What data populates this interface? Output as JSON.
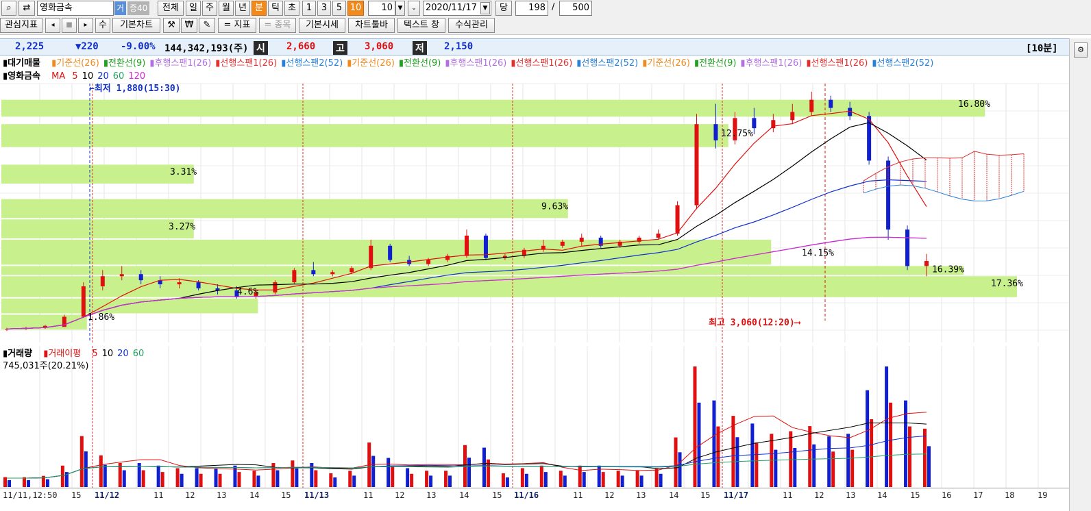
{
  "toolbar": {
    "stock_name": "영화금속",
    "tag_trade": "거",
    "tag_rate": "증40",
    "period_all": "전체",
    "period_day": "일",
    "period_week": "주",
    "period_month": "월",
    "period_year": "년",
    "period_minute": "분",
    "period_tick": "틱",
    "period_second": "초",
    "n1": "1",
    "n3": "3",
    "n5": "5",
    "n10": "10",
    "interval_value": "10",
    "date_value": "2020/11/17",
    "dang_label": "당",
    "count_value": "198",
    "count_slash": "/",
    "count_total": "500"
  },
  "toolbar2": {
    "interest": "관심지표",
    "su": "수",
    "basic_chart": "기본차트",
    "indicator": "= 지표",
    "item": "= 종목",
    "basic_quote": "기본시세",
    "chart_toolbar": "차트툴바",
    "text_window": "텍스트 창",
    "formula": "수식관리"
  },
  "quote": {
    "price": "2,225",
    "change": "▼220",
    "change_pct": "-9.00%",
    "volume": "144,342,193(주)",
    "open_label": "시",
    "open": "2,660",
    "high_label": "고",
    "high": "3,060",
    "low_label": "저",
    "low": "2,150",
    "interval": "[10분]"
  },
  "legend1": {
    "title": "대기매물",
    "items": [
      {
        "label": "기준선(26)",
        "color": "#f08a1c"
      },
      {
        "label": "전환선(9)",
        "color": "#20a020"
      },
      {
        "label": "후행스팬1(26)",
        "color": "#b070e0"
      },
      {
        "label": "선행스팬1(26)",
        "color": "#e03030"
      },
      {
        "label": "선행스팬2(52)",
        "color": "#2a80d8"
      },
      {
        "label": "기준선(26)",
        "color": "#f08a1c"
      },
      {
        "label": "전환선(9)",
        "color": "#20a020"
      },
      {
        "label": "후행스팬1(26)",
        "color": "#b070e0"
      },
      {
        "label": "선행스팬1(26)",
        "color": "#e03030"
      },
      {
        "label": "선행스팬2(52)",
        "color": "#2a80d8"
      },
      {
        "label": "기준선(26)",
        "color": "#f08a1c"
      },
      {
        "label": "전환선(9)",
        "color": "#20a020"
      },
      {
        "label": "후행스팬1(26)",
        "color": "#b070e0"
      },
      {
        "label": "선행스팬1(26)",
        "color": "#e03030"
      },
      {
        "label": "선행스팬2(52)",
        "color": "#2a80d8"
      }
    ]
  },
  "legend2": {
    "title": "영화금속",
    "ma": "MA",
    "items": [
      {
        "label": "5",
        "color": "#e01010"
      },
      {
        "label": "10",
        "color": "#000000"
      },
      {
        "label": "20",
        "color": "#1030d0"
      },
      {
        "label": "60",
        "color": "#20a060"
      },
      {
        "label": "120",
        "color": "#e020e0"
      }
    ]
  },
  "annotations": {
    "low_mark": "←최저 1,880(15:30)",
    "high_mark": "최고 3,060(12:20)⟶",
    "pcts": [
      "16.80%",
      "12.75%",
      "3.31%",
      "9.63%",
      "3.27%",
      "14.15%",
      "16.39%",
      "4.6%",
      "17.36%",
      "1.86%"
    ]
  },
  "volume_legend": {
    "title": "거래량",
    "ma_title": "거래이평",
    "items": [
      {
        "label": "5",
        "color": "#e01010"
      },
      {
        "label": "10",
        "color": "#000000"
      },
      {
        "label": "20",
        "color": "#1030d0"
      },
      {
        "label": "60",
        "color": "#20a060"
      }
    ],
    "current": "745,031주(20.21%)"
  },
  "xaxis": {
    "labels": [
      "11/11,12:50",
      "15",
      "11/12",
      "11",
      "12",
      "13",
      "14",
      "15",
      "11/13",
      "11",
      "12",
      "13",
      "14",
      "15",
      "11/16",
      "11",
      "12",
      "13",
      "14",
      "15",
      "11/17",
      "11",
      "12",
      "13",
      "14",
      "15",
      "16",
      "17",
      "18",
      "19"
    ],
    "day_labels": [
      "11/12",
      "11/13",
      "11/16",
      "11/17"
    ]
  },
  "colors": {
    "up": "#e01010",
    "down": "#1020d0",
    "volume_profile": "#c8f08c",
    "cloud": "#e03030",
    "day_divider": "#e03030"
  },
  "chart_data": {
    "type": "candlestick",
    "title": "영화금속",
    "interval": "10분",
    "ylim": [
      1850,
      3100
    ],
    "dates": [
      "11/11",
      "11/12",
      "11/13",
      "11/16",
      "11/17"
    ],
    "ohlc": [
      [
        1890,
        1895,
        1880,
        1890
      ],
      [
        1890,
        1900,
        1885,
        1895
      ],
      [
        1895,
        1910,
        1890,
        1905
      ],
      [
        1900,
        1960,
        1900,
        1950
      ],
      [
        1950,
        2120,
        1945,
        2100
      ],
      [
        2100,
        2180,
        2080,
        2150
      ],
      [
        2150,
        2200,
        2130,
        2160
      ],
      [
        2160,
        2180,
        2110,
        2130
      ],
      [
        2130,
        2150,
        2090,
        2110
      ],
      [
        2110,
        2140,
        2090,
        2120
      ],
      [
        2120,
        2130,
        2080,
        2090
      ],
      [
        2090,
        2110,
        2060,
        2080
      ],
      [
        2080,
        2100,
        2040,
        2050
      ],
      [
        2050,
        2080,
        2040,
        2070
      ],
      [
        2070,
        2130,
        2060,
        2120
      ],
      [
        2120,
        2190,
        2110,
        2180
      ],
      [
        2180,
        2220,
        2150,
        2160
      ],
      [
        2160,
        2180,
        2150,
        2170
      ],
      [
        2170,
        2200,
        2160,
        2190
      ],
      [
        2190,
        2330,
        2180,
        2300
      ],
      [
        2300,
        2310,
        2220,
        2230
      ],
      [
        2230,
        2250,
        2200,
        2210
      ],
      [
        2210,
        2240,
        2200,
        2230
      ],
      [
        2230,
        2260,
        2220,
        2250
      ],
      [
        2250,
        2380,
        2240,
        2350
      ],
      [
        2350,
        2360,
        2230,
        2240
      ],
      [
        2240,
        2260,
        2230,
        2250
      ],
      [
        2250,
        2290,
        2240,
        2280
      ],
      [
        2280,
        2330,
        2270,
        2300
      ],
      [
        2300,
        2330,
        2290,
        2320
      ],
      [
        2320,
        2360,
        2300,
        2340
      ],
      [
        2340,
        2350,
        2290,
        2300
      ],
      [
        2300,
        2330,
        2290,
        2320
      ],
      [
        2320,
        2350,
        2310,
        2340
      ],
      [
        2340,
        2380,
        2330,
        2360
      ],
      [
        2360,
        2520,
        2350,
        2500
      ],
      [
        2500,
        2950,
        2480,
        2900
      ],
      [
        2900,
        3000,
        2780,
        2820
      ],
      [
        2820,
        2960,
        2800,
        2930
      ],
      [
        2930,
        2980,
        2850,
        2880
      ],
      [
        2880,
        2950,
        2860,
        2920
      ],
      [
        2920,
        3000,
        2900,
        2960
      ],
      [
        2960,
        3060,
        2940,
        3020
      ],
      [
        3020,
        3040,
        2960,
        2980
      ],
      [
        2980,
        3010,
        2920,
        2940
      ],
      [
        2940,
        2960,
        2700,
        2720
      ],
      [
        2720,
        2740,
        2330,
        2380
      ],
      [
        2380,
        2400,
        2180,
        2200
      ],
      [
        2200,
        2260,
        2150,
        2225
      ]
    ],
    "volume_ma_periods": [
      5,
      10,
      20,
      60
    ],
    "price_ma_periods": [
      5,
      10,
      20,
      60,
      120
    ]
  }
}
